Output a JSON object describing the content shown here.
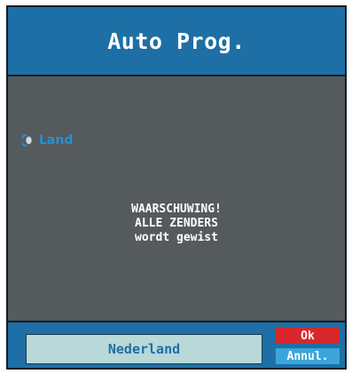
{
  "dialog": {
    "title": "Auto Prog."
  },
  "country_option": {
    "label": "Land",
    "icon": "radio-selected-icon"
  },
  "warning": {
    "line1": "WAARSCHUWING!",
    "line2": "ALLE ZENDERS",
    "line3": "wordt gewist"
  },
  "footer": {
    "country_value": "Nederland",
    "ok_label": "Ok",
    "cancel_label": "Annul."
  },
  "colors": {
    "title_bar": "#1e6fa5",
    "content_bg": "#555a5d",
    "accent_blue": "#2a8fd0",
    "ok_red": "#d8282d",
    "cancel_blue": "#3aa6dc",
    "field_bg": "#b9d8d8"
  }
}
